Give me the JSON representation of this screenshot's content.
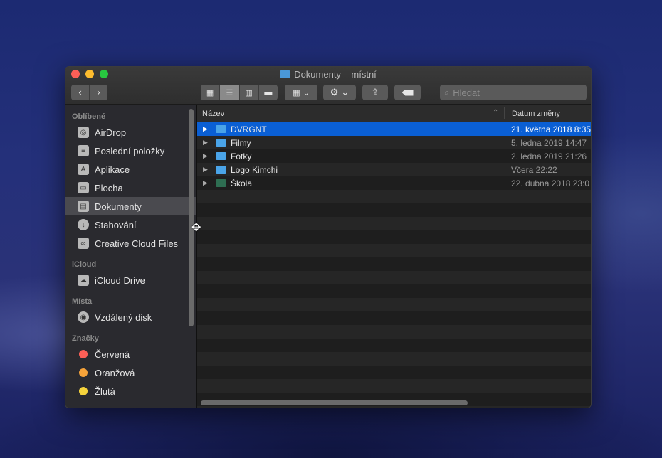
{
  "window": {
    "title": "Dokumenty – místní"
  },
  "toolbar": {
    "back": "‹",
    "forward": "›",
    "search_placeholder": "Hledat"
  },
  "sidebar": {
    "sections": [
      {
        "label": "Oblíbené",
        "items": [
          {
            "label": "AirDrop",
            "icon": "airdrop-icon"
          },
          {
            "label": "Poslední položky",
            "icon": "recents-icon"
          },
          {
            "label": "Aplikace",
            "icon": "applications-icon"
          },
          {
            "label": "Plocha",
            "icon": "desktop-icon"
          },
          {
            "label": "Dokumenty",
            "icon": "documents-icon",
            "selected": true
          },
          {
            "label": "Stahování",
            "icon": "downloads-icon"
          },
          {
            "label": "Creative Cloud Files",
            "icon": "creative-cloud-icon"
          }
        ]
      },
      {
        "label": "iCloud",
        "items": [
          {
            "label": "iCloud Drive",
            "icon": "cloud-icon"
          }
        ]
      },
      {
        "label": "Místa",
        "items": [
          {
            "label": "Vzdálený disk",
            "icon": "remote-disc-icon"
          }
        ]
      },
      {
        "label": "Značky",
        "items": [
          {
            "label": "Červená",
            "color": "#fc5f57"
          },
          {
            "label": "Oranžová",
            "color": "#f6a33a"
          },
          {
            "label": "Žlutá",
            "color": "#f5d33c"
          }
        ]
      }
    ]
  },
  "columns": {
    "name": "Název",
    "date": "Datum změny"
  },
  "files": [
    {
      "name": "DVRGNT",
      "date": "21. května 2018 8:35",
      "selected": true,
      "folder_color": "#4aa4e8"
    },
    {
      "name": "Filmy",
      "date": "5. ledna 2019 14:47",
      "folder_color": "#4aa4e8"
    },
    {
      "name": "Fotky",
      "date": "2. ledna 2019 21:26",
      "folder_color": "#4aa4e8"
    },
    {
      "name": "Logo Kimchi",
      "date": "Včera 22:22",
      "folder_color": "#4aa4e8"
    },
    {
      "name": "Škola",
      "date": "22. dubna 2018 23:0",
      "folder_color": "#2e6e52"
    }
  ]
}
